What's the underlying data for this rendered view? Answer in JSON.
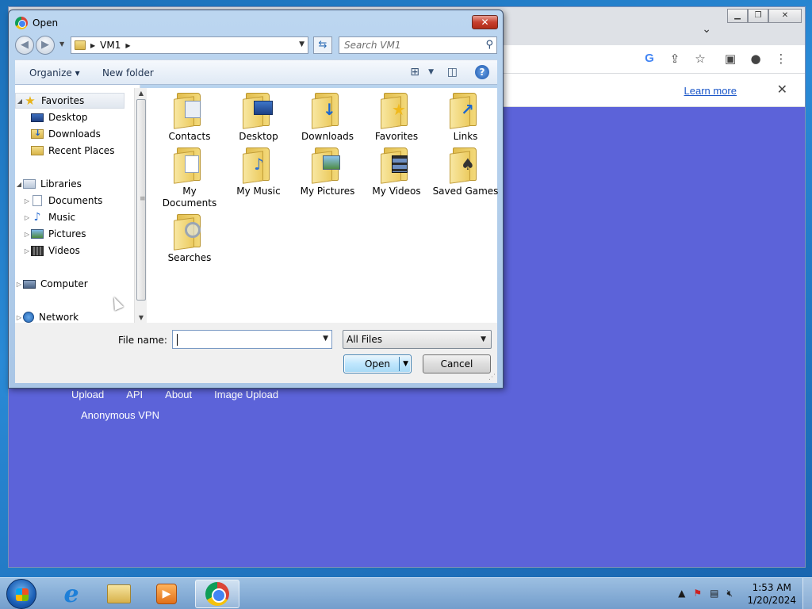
{
  "browser": {
    "info_bar": {
      "learn_more": "Learn more"
    },
    "page_links": [
      "Upload",
      "API",
      "About",
      "Image Upload"
    ],
    "page_link_2": "Anonymous VPN"
  },
  "dialog": {
    "title": "Open",
    "address": {
      "crumb": "VM1"
    },
    "search_placeholder": "Search VM1",
    "toolbar": {
      "organize": "Organize",
      "new_folder": "New folder"
    },
    "nav": {
      "favorites": "Favorites",
      "desktop": "Desktop",
      "downloads": "Downloads",
      "recent": "Recent Places",
      "libraries": "Libraries",
      "documents": "Documents",
      "music": "Music",
      "pictures": "Pictures",
      "videos": "Videos",
      "computer": "Computer",
      "network": "Network"
    },
    "files": {
      "contacts": "Contacts",
      "desktop": "Desktop",
      "downloads": "Downloads",
      "favorites": "Favorites",
      "links": "Links",
      "my_documents": "My Documents",
      "my_music": "My Music",
      "my_pictures": "My Pictures",
      "my_videos": "My Videos",
      "saved_games": "Saved Games",
      "searches": "Searches"
    },
    "file_name_label": "File name:",
    "file_name_value": "",
    "filter": "All Files",
    "open_button": "Open",
    "cancel_button": "Cancel"
  },
  "taskbar": {
    "time": "1:53 AM",
    "date": "1/20/2024"
  }
}
